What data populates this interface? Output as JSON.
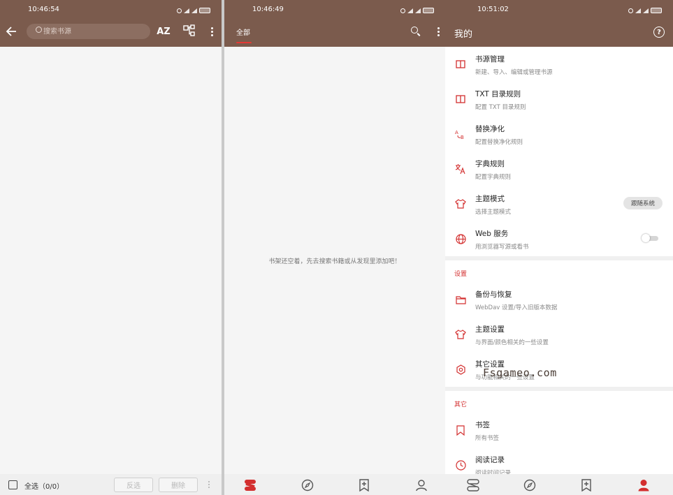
{
  "colors": {
    "accent": "#d32f2f",
    "toolbar": "#7b5b4d",
    "background": "#f5f5f5"
  },
  "screen_source": {
    "status_time": "10:46:54",
    "search_placeholder": "搜索书源",
    "sort_label": "AZ",
    "select_all": "全选（0/0）",
    "invert_label": "反选",
    "delete_label": "删除",
    "icons": [
      "arrow-left-icon",
      "search-icon",
      "sort-az-icon",
      "group-icon",
      "more-vert-icon"
    ]
  },
  "screen_bookshelf": {
    "status_time": "10:46:49",
    "tab_all": "全部",
    "empty_hint": "书架还空着，先去搜索书籍或从发现里添加吧！",
    "nav_icons": [
      "bookshelf-icon",
      "compass-icon",
      "bookmark-add-icon",
      "person-icon"
    ]
  },
  "screen_mine": {
    "status_time": "10:51:02",
    "title": "我的",
    "top_items": [
      {
        "title": "书源管理",
        "subtitle": "新建、导入、编辑或管理书源",
        "icon": "book-open-icon"
      },
      {
        "title": "TXT 目录规则",
        "subtitle": "配置 TXT 目录规则",
        "icon": "book-open-icon"
      },
      {
        "title": "替换净化",
        "subtitle": "配置替换净化规则",
        "icon": "replace-ab-icon"
      },
      {
        "title": "字典规则",
        "subtitle": "配置字典规则",
        "icon": "translate-icon"
      },
      {
        "title": "主题模式",
        "subtitle": "选择主题模式",
        "icon": "shirt-icon",
        "chip": "跟随系统"
      },
      {
        "title": "Web 服务",
        "subtitle": "用浏览器写源或看书",
        "icon": "globe-icon",
        "toggle": false
      }
    ],
    "settings_header": "设置",
    "settings_items": [
      {
        "title": "备份与恢复",
        "subtitle": "WebDav 设置/导入旧版本数据",
        "icon": "folder-icon"
      },
      {
        "title": "主题设置",
        "subtitle": "与界面/颜色相关的一些设置",
        "icon": "shirt-icon"
      },
      {
        "title": "其它设置",
        "subtitle": "与功能相关的一些设置",
        "icon": "settings-gear-icon"
      }
    ],
    "other_header": "其它",
    "other_items": [
      {
        "title": "书签",
        "subtitle": "所有书签",
        "icon": "bookmark-icon"
      },
      {
        "title": "阅读记录",
        "subtitle": "阅读时间记录",
        "icon": "clock-icon"
      }
    ],
    "watermark": "Fsgameo.com",
    "nav_icons": [
      "bookshelf-icon",
      "compass-icon",
      "bookmark-add-icon",
      "person-icon"
    ]
  }
}
